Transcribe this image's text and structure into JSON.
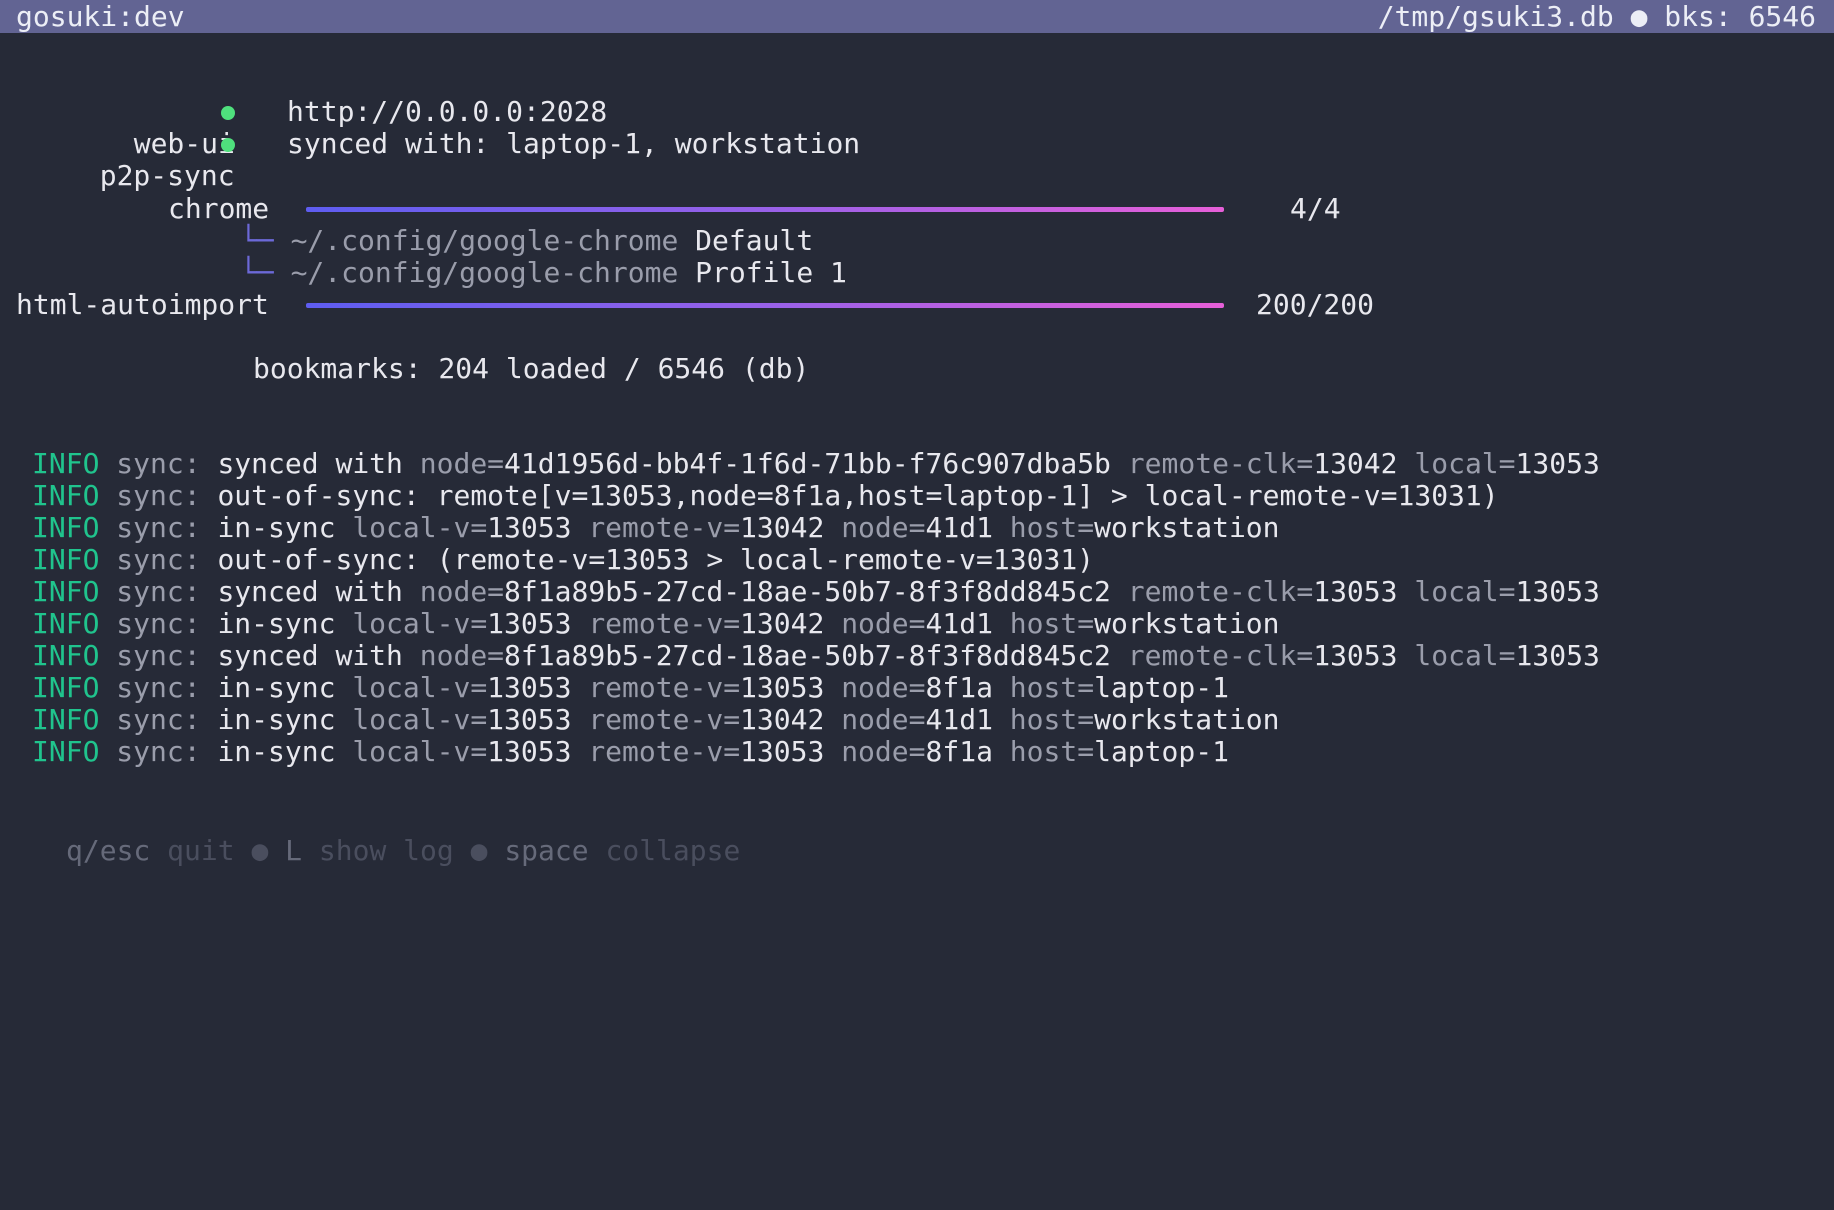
{
  "status_bar": {
    "app_name": "gosuki:dev",
    "db_path": "/tmp/gsuki3.db",
    "separator": "●",
    "bookmarks_count": "bks: 6546"
  },
  "services": [
    {
      "name": "web-ui",
      "value": "http://0.0.0.0:2028"
    },
    {
      "name": "p2p-sync",
      "value": "synced with: laptop-1, workstation"
    }
  ],
  "modules": [
    {
      "name": "chrome",
      "progress_text": "4/4",
      "progress": 1.0,
      "profiles": [
        {
          "branch": "└─",
          "path": "~/.config/google-chrome",
          "profile": "Default"
        },
        {
          "branch": "└─",
          "path": "~/.config/google-chrome",
          "profile": "Profile 1"
        }
      ]
    },
    {
      "name": "html-autoimport",
      "progress_text": "200/200",
      "progress": 1.0,
      "profiles": []
    }
  ],
  "summary": "bookmarks: 204 loaded / 6546 (db)",
  "log_lines": [
    {
      "level": "INFO",
      "src": "sync:",
      "parts": [
        {
          "t": "synced with ",
          "c": "w"
        },
        {
          "t": "node=",
          "c": "m"
        },
        {
          "t": "41d1956d-bb4f-1f6d-71bb-f76c907dba5b ",
          "c": "w"
        },
        {
          "t": "remote-clk=",
          "c": "m"
        },
        {
          "t": "13042 ",
          "c": "w"
        },
        {
          "t": "local=",
          "c": "m"
        },
        {
          "t": "13053",
          "c": "w"
        }
      ]
    },
    {
      "level": "INFO",
      "src": "sync:",
      "parts": [
        {
          "t": "out-of-sync: remote[v=13053,node=8f1a,host=laptop-1] > local-remote-v=13031)",
          "c": "w"
        }
      ]
    },
    {
      "level": "INFO",
      "src": "sync:",
      "parts": [
        {
          "t": "in-sync ",
          "c": "w"
        },
        {
          "t": "local-v=",
          "c": "m"
        },
        {
          "t": "13053 ",
          "c": "w"
        },
        {
          "t": "remote-v=",
          "c": "m"
        },
        {
          "t": "13042 ",
          "c": "w"
        },
        {
          "t": "node=",
          "c": "m"
        },
        {
          "t": "41d1 ",
          "c": "w"
        },
        {
          "t": "host=",
          "c": "m"
        },
        {
          "t": "workstation",
          "c": "w"
        }
      ]
    },
    {
      "level": "INFO",
      "src": "sync:",
      "parts": [
        {
          "t": "out-of-sync: (remote-v=13053 > local-remote-v=13031)",
          "c": "w"
        }
      ]
    },
    {
      "level": "INFO",
      "src": "sync:",
      "parts": [
        {
          "t": "synced with ",
          "c": "w"
        },
        {
          "t": "node=",
          "c": "m"
        },
        {
          "t": "8f1a89b5-27cd-18ae-50b7-8f3f8dd845c2 ",
          "c": "w"
        },
        {
          "t": "remote-clk=",
          "c": "m"
        },
        {
          "t": "13053 ",
          "c": "w"
        },
        {
          "t": "local=",
          "c": "m"
        },
        {
          "t": "13053",
          "c": "w"
        }
      ]
    },
    {
      "level": "INFO",
      "src": "sync:",
      "parts": [
        {
          "t": "in-sync ",
          "c": "w"
        },
        {
          "t": "local-v=",
          "c": "m"
        },
        {
          "t": "13053 ",
          "c": "w"
        },
        {
          "t": "remote-v=",
          "c": "m"
        },
        {
          "t": "13042 ",
          "c": "w"
        },
        {
          "t": "node=",
          "c": "m"
        },
        {
          "t": "41d1 ",
          "c": "w"
        },
        {
          "t": "host=",
          "c": "m"
        },
        {
          "t": "workstation",
          "c": "w"
        }
      ]
    },
    {
      "level": "INFO",
      "src": "sync:",
      "parts": [
        {
          "t": "synced with ",
          "c": "w"
        },
        {
          "t": "node=",
          "c": "m"
        },
        {
          "t": "8f1a89b5-27cd-18ae-50b7-8f3f8dd845c2 ",
          "c": "w"
        },
        {
          "t": "remote-clk=",
          "c": "m"
        },
        {
          "t": "13053 ",
          "c": "w"
        },
        {
          "t": "local=",
          "c": "m"
        },
        {
          "t": "13053",
          "c": "w"
        }
      ]
    },
    {
      "level": "INFO",
      "src": "sync:",
      "parts": [
        {
          "t": "in-sync ",
          "c": "w"
        },
        {
          "t": "local-v=",
          "c": "m"
        },
        {
          "t": "13053 ",
          "c": "w"
        },
        {
          "t": "remote-v=",
          "c": "m"
        },
        {
          "t": "13053 ",
          "c": "w"
        },
        {
          "t": "node=",
          "c": "m"
        },
        {
          "t": "8f1a ",
          "c": "w"
        },
        {
          "t": "host=",
          "c": "m"
        },
        {
          "t": "laptop-1",
          "c": "w"
        }
      ]
    },
    {
      "level": "INFO",
      "src": "sync:",
      "parts": [
        {
          "t": "in-sync ",
          "c": "w"
        },
        {
          "t": "local-v=",
          "c": "m"
        },
        {
          "t": "13053 ",
          "c": "w"
        },
        {
          "t": "remote-v=",
          "c": "m"
        },
        {
          "t": "13042 ",
          "c": "w"
        },
        {
          "t": "node=",
          "c": "m"
        },
        {
          "t": "41d1 ",
          "c": "w"
        },
        {
          "t": "host=",
          "c": "m"
        },
        {
          "t": "workstation",
          "c": "w"
        }
      ]
    },
    {
      "level": "INFO",
      "src": "sync:",
      "parts": [
        {
          "t": "in-sync ",
          "c": "w"
        },
        {
          "t": "local-v=",
          "c": "m"
        },
        {
          "t": "13053 ",
          "c": "w"
        },
        {
          "t": "remote-v=",
          "c": "m"
        },
        {
          "t": "13053 ",
          "c": "w"
        },
        {
          "t": "node=",
          "c": "m"
        },
        {
          "t": "8f1a ",
          "c": "w"
        },
        {
          "t": "host=",
          "c": "m"
        },
        {
          "t": "laptop-1",
          "c": "w"
        }
      ]
    }
  ],
  "help": [
    {
      "key": "q/esc",
      "action": "quit"
    },
    {
      "key": "L",
      "action": "show log"
    },
    {
      "key": "space",
      "action": "collapse"
    }
  ],
  "help_separator": "●",
  "colors": {
    "background": "#262a37",
    "status_bar": "#626493",
    "ok_dot": "#4fe07d",
    "info_level": "#20c48d",
    "progress_start": "#5e5df0",
    "progress_end": "#e65fd8"
  }
}
